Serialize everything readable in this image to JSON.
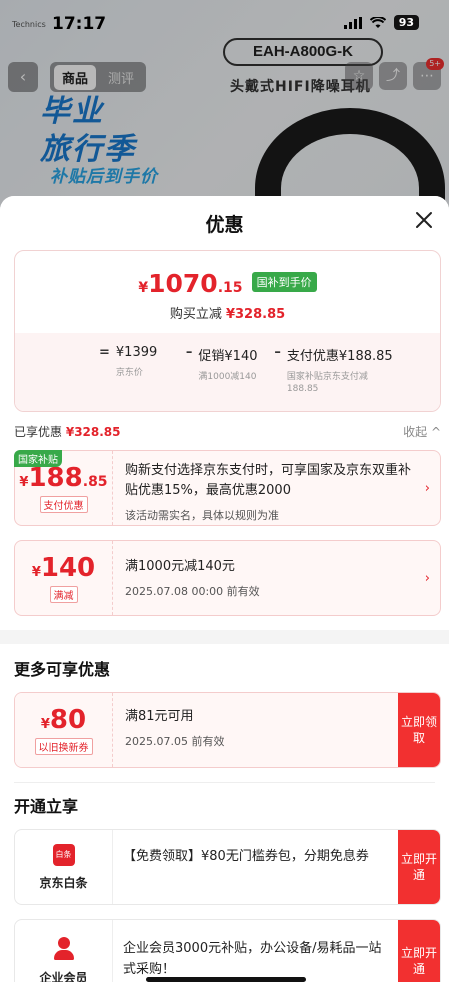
{
  "status": {
    "time": "17:17",
    "battery": "93"
  },
  "background": {
    "brand": "Technics",
    "model": "EAH-A800G-K",
    "subtitle": "头戴式HIFI降噪耳机",
    "promo_line1": "毕业",
    "promo_line2": "旅行季",
    "promo_line3": "补贴后到手价",
    "nav": {
      "back_icon": "chevron-left-icon",
      "tabs": [
        "商品",
        "测评"
      ],
      "badge": "5+"
    }
  },
  "sheet": {
    "title": "优惠",
    "close_icon": "close-icon",
    "summary": {
      "currency": "¥",
      "price_int": "1070",
      "price_dec": ".15",
      "badge": "国补到手价",
      "reduce_label": "购买立减",
      "reduce_value": "¥328.85",
      "formula": [
        {
          "op": "=",
          "value": "¥1399",
          "sub": "京东价"
        },
        {
          "op": "–",
          "value": "促销¥140",
          "sub": "满1000减140"
        },
        {
          "op": "–",
          "value": "支付优惠¥188.85",
          "sub": "国家补贴京东支付减188.85"
        }
      ]
    },
    "enjoyed": {
      "label": "已享优惠",
      "value": "¥328.85",
      "collapse": "收起 ^"
    },
    "enjoyed_coupons": [
      {
        "ribbon": "国家补贴",
        "currency": "¥",
        "amount": "188",
        "amount_dec": ".85",
        "tag": "支付优惠",
        "title": "购新支付选择京东支付时，可享国家及京东双重补贴优惠15%，最高优惠2000",
        "sub": "该活动需实名，具体以规则为准",
        "arrow": "›"
      },
      {
        "ribbon": "",
        "currency": "¥",
        "amount": "140",
        "amount_dec": "",
        "tag": "满减",
        "title": "满1000元减140元",
        "sub": "2025.07.08 00:00 前有效",
        "arrow": "›"
      }
    ],
    "more": {
      "title": "更多可享优惠",
      "coupon": {
        "currency": "¥",
        "amount": "80",
        "tag": "以旧换新券",
        "title": "满81元可用",
        "sub": "2025.07.05 前有效",
        "button": "立即领取"
      }
    },
    "open": {
      "title": "开通立享",
      "items": [
        {
          "icon_text": "白条",
          "name": "京东白条",
          "text": "【免费领取】¥80无门槛券包，分期免息券",
          "button": "立即开通"
        },
        {
          "icon_text": "",
          "name": "企业会员",
          "text": "企业会员3000元补贴，办公设备/易耗品一站式采购！",
          "button": "立即开通"
        }
      ]
    }
  },
  "colors": {
    "accent": "#e3232b",
    "green_badge": "#38a949",
    "button": "#f23030"
  }
}
